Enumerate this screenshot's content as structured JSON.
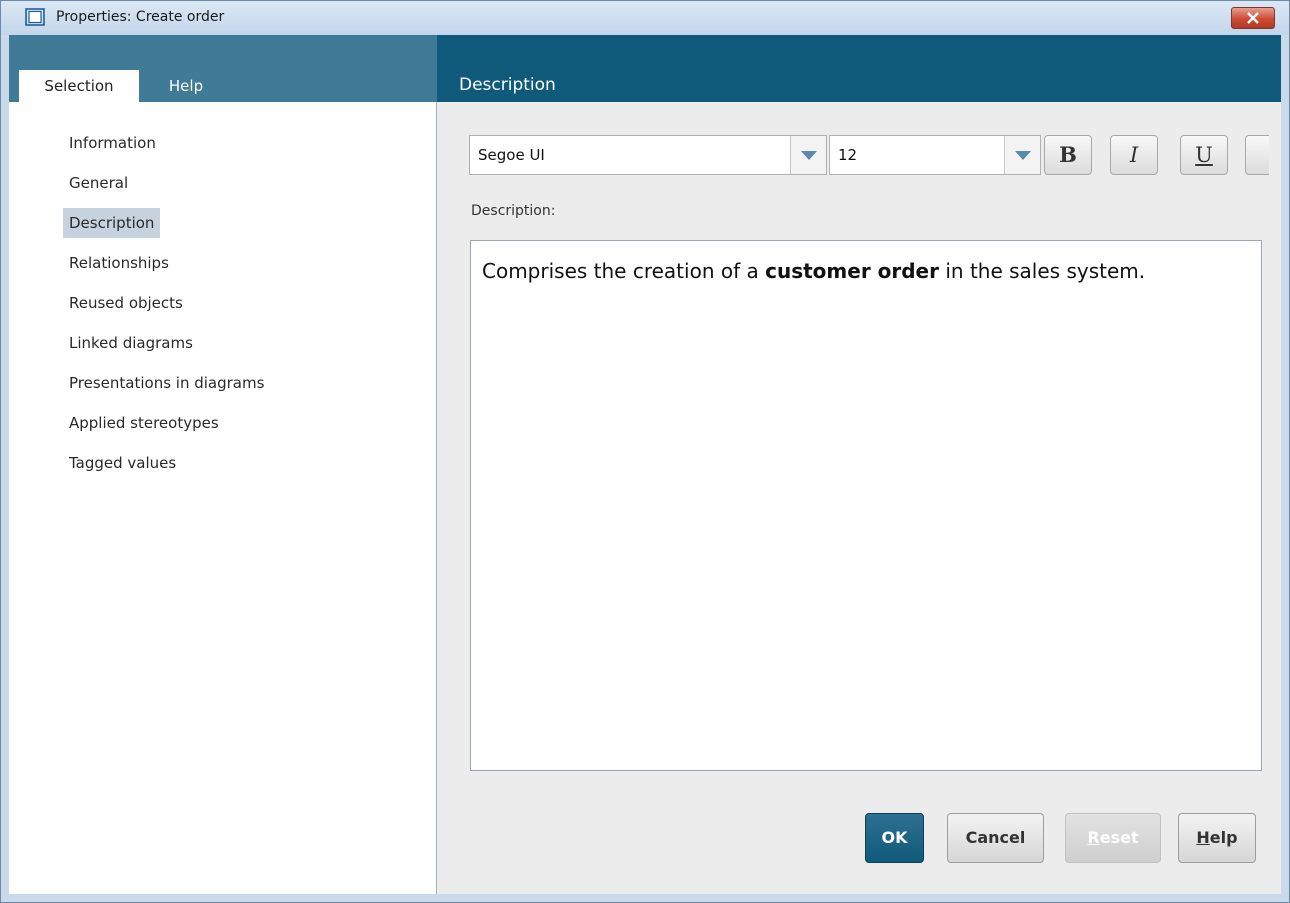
{
  "window": {
    "title": "Properties: Create order",
    "icon": "window-icon",
    "close_icon": "close-icon"
  },
  "tabs": [
    {
      "label": "Selection",
      "selected": true
    },
    {
      "label": "Help",
      "selected": false
    }
  ],
  "sidebar": {
    "items": [
      {
        "label": "Information"
      },
      {
        "label": "General"
      },
      {
        "label": "Description",
        "selected": true
      },
      {
        "label": "Relationships"
      },
      {
        "label": "Reused objects"
      },
      {
        "label": "Linked diagrams"
      },
      {
        "label": "Presentations in diagrams"
      },
      {
        "label": "Applied stereotypes"
      },
      {
        "label": "Tagged values"
      }
    ]
  },
  "main": {
    "header": "Description",
    "toolbar": {
      "font_family": "Segoe UI",
      "font_size": "12",
      "bold_label": "B",
      "italic_label": "I",
      "underline_label": "U"
    },
    "description_label": "Description:",
    "description": {
      "before": "Comprises the creation of a ",
      "bold": "customer order",
      "after": " in the sales system."
    }
  },
  "buttons": {
    "ok": "OK",
    "cancel": "Cancel",
    "reset_first": "R",
    "reset_rest": "eset",
    "help_first": "H",
    "help_rest": "elp"
  },
  "colors": {
    "header": "#0f5a7a",
    "tabbar": "#3f7a96",
    "selected_item": "#c6d3de",
    "content_bg": "#ececec"
  }
}
